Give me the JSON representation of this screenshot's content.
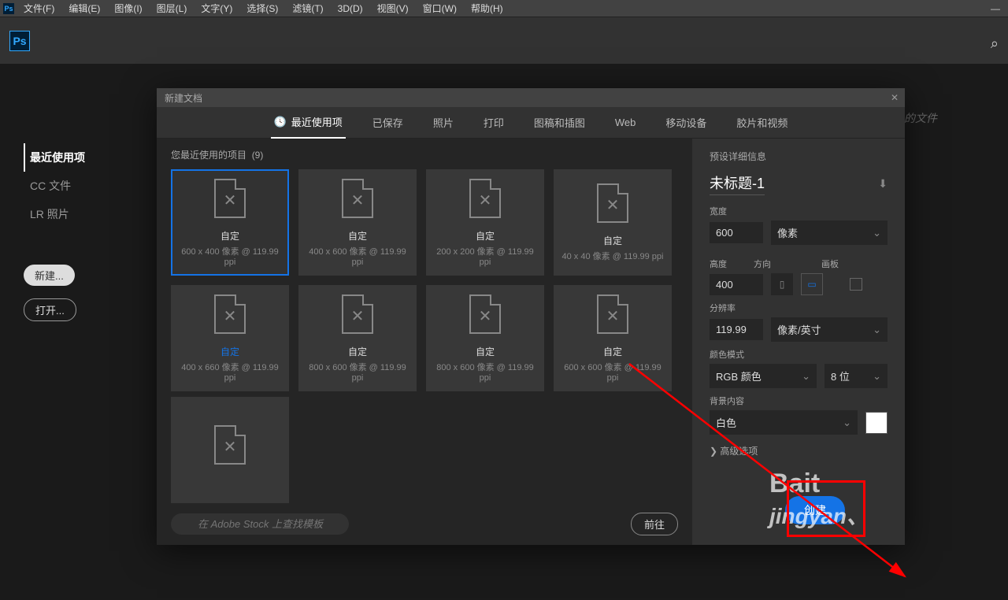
{
  "menubar": [
    "文件(F)",
    "编辑(E)",
    "图像(I)",
    "图层(L)",
    "文字(Y)",
    "选择(S)",
    "滤镜(T)",
    "3D(D)",
    "视图(V)",
    "窗口(W)",
    "帮助(H)"
  ],
  "sidebar": {
    "items": [
      "最近使用项",
      "CC 文件",
      "LR 照片"
    ],
    "new_btn": "新建...",
    "open_btn": "打开..."
  },
  "faded": "的文件",
  "dialog": {
    "title": "新建文档",
    "tabs": [
      "最近使用项",
      "已保存",
      "照片",
      "打印",
      "图稿和插图",
      "Web",
      "移动设备",
      "胶片和视频"
    ],
    "recent_label": "您最近使用的项目",
    "recent_count": "(9)",
    "cards": [
      {
        "name": "自定",
        "meta": "600 x 400 像素 @ 119.99 ppi",
        "selected": true
      },
      {
        "name": "自定",
        "meta": "400 x 600 像素 @ 119.99 ppi"
      },
      {
        "name": "自定",
        "meta": "200 x 200 像素 @ 119.99 ppi"
      },
      {
        "name": "自定",
        "meta": "40 x 40 像素 @ 119.99 ppi"
      },
      {
        "name": "自定",
        "meta": "400 x 660 像素 @ 119.99 ppi",
        "blue": true
      },
      {
        "name": "自定",
        "meta": "800 x 600 像素 @ 119.99 ppi"
      },
      {
        "name": "自定",
        "meta": "800 x 600 像素 @ 119.99 ppi"
      },
      {
        "name": "自定",
        "meta": "600 x 600 像素 @ 119.99 ppi"
      }
    ],
    "search_placeholder": "在 Adobe Stock 上查找模板",
    "go_btn": "前往"
  },
  "panel": {
    "section_title": "预设详细信息",
    "doc_name": "未标题-1",
    "width_label": "宽度",
    "width_value": "600",
    "width_unit": "像素",
    "height_label": "高度",
    "height_value": "400",
    "orient_label": "方向",
    "artboard_label": "画板",
    "resolution_label": "分辨率",
    "resolution_value": "119.99",
    "resolution_unit": "像素/英寸",
    "colormode_label": "颜色模式",
    "colormode_value": "RGB 颜色",
    "bitdepth": "8 位",
    "bg_label": "背景内容",
    "bg_value": "白色",
    "advanced": "高级选项",
    "create_btn": "创建"
  },
  "watermark": {
    "top": "Bait",
    "bottom": "jingyan、"
  }
}
